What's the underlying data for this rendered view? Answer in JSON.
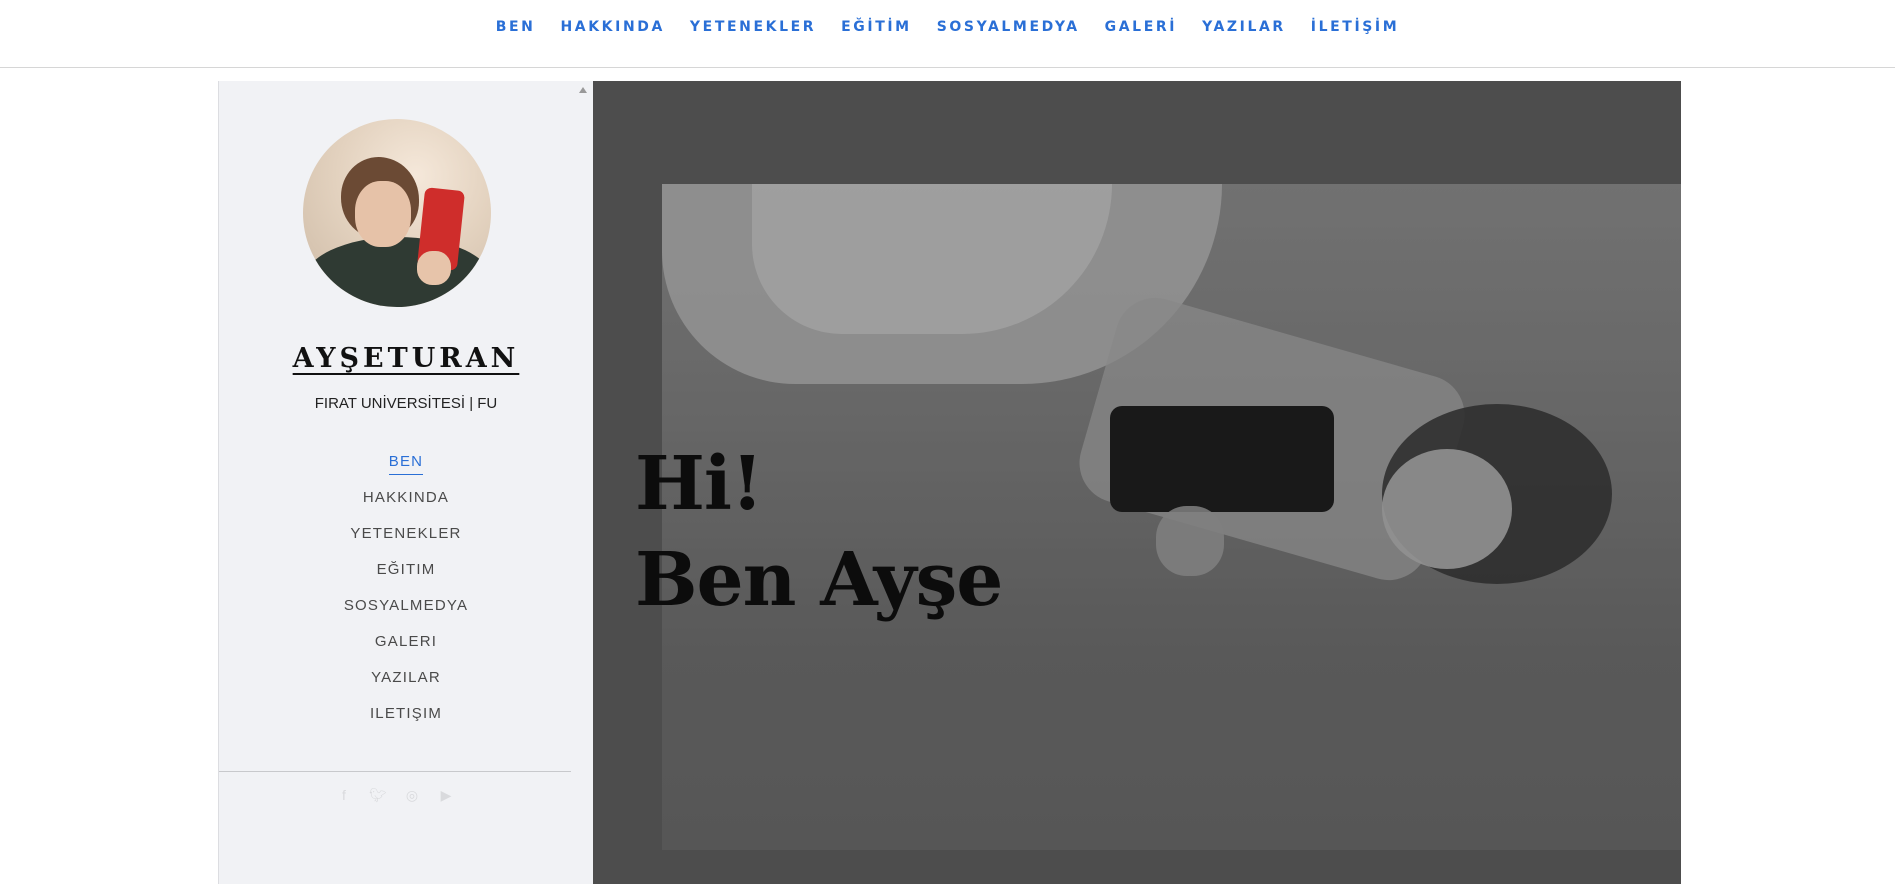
{
  "topnav": {
    "items": [
      "BEN",
      "HAKKINDA",
      "YETENEKLER",
      "EĞİTİM",
      "SOSYALMEDYA",
      "GALERİ",
      "YAZILAR",
      "İLETİŞİM"
    ]
  },
  "sidebar": {
    "name": "AYŞETURAN",
    "subtitle": "FIRAT UNİVERSİTESİ | FU",
    "menu": [
      "BEN",
      "HAKKINDA",
      "YETENEKLER",
      "EĞITIM",
      "SOSYALMEDYA",
      "GALERI",
      "YAZILAR",
      "ILETIŞIM"
    ],
    "active_index": 0,
    "social_icons": [
      "facebook-icon",
      "twitter-icon",
      "instagram-icon",
      "youtube-icon"
    ]
  },
  "hero": {
    "line1": "Hi!",
    "line2": "Ben Ayşe"
  },
  "colors": {
    "accent": "#2a6fd6",
    "sidebar_bg": "#f1f2f5",
    "hero_bg": "#5a5a5a"
  }
}
